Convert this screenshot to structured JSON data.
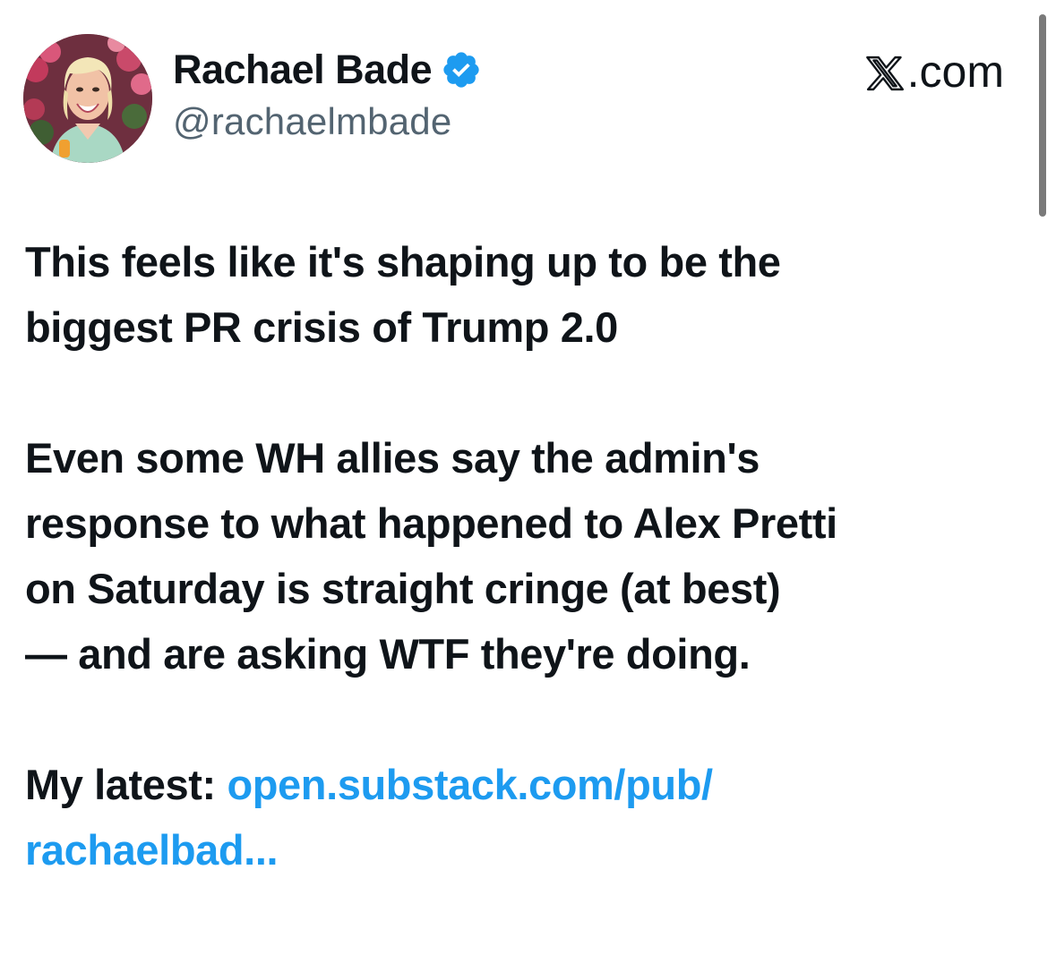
{
  "author": {
    "display_name": "Rachael Bade",
    "handle": "@rachaelmbade",
    "verified": true,
    "avatar_icon": "profile-photo"
  },
  "brand": {
    "label": ".com",
    "logo_icon": "x-logo-icon"
  },
  "tweet": {
    "paragraph1": {
      "line1": "This feels like it's shaping up to be the",
      "line2": "biggest PR crisis of Trump 2.0"
    },
    "paragraph2": {
      "line1": "Even some WH allies say the admin's",
      "line2": "response to what happened to Alex Pretti",
      "line3": "on Saturday is straight cringe (at best)",
      "line4": "— and are asking WTF they're doing."
    },
    "paragraph3": {
      "prefix": "My latest: ",
      "link_line1": "open.substack.com/pub/",
      "link_line2": "rachaelbad..."
    }
  },
  "colors": {
    "text": "#0f1419",
    "secondary_text": "#536471",
    "link": "#1d9bf0",
    "verified_badge": "#1d9bf0"
  }
}
